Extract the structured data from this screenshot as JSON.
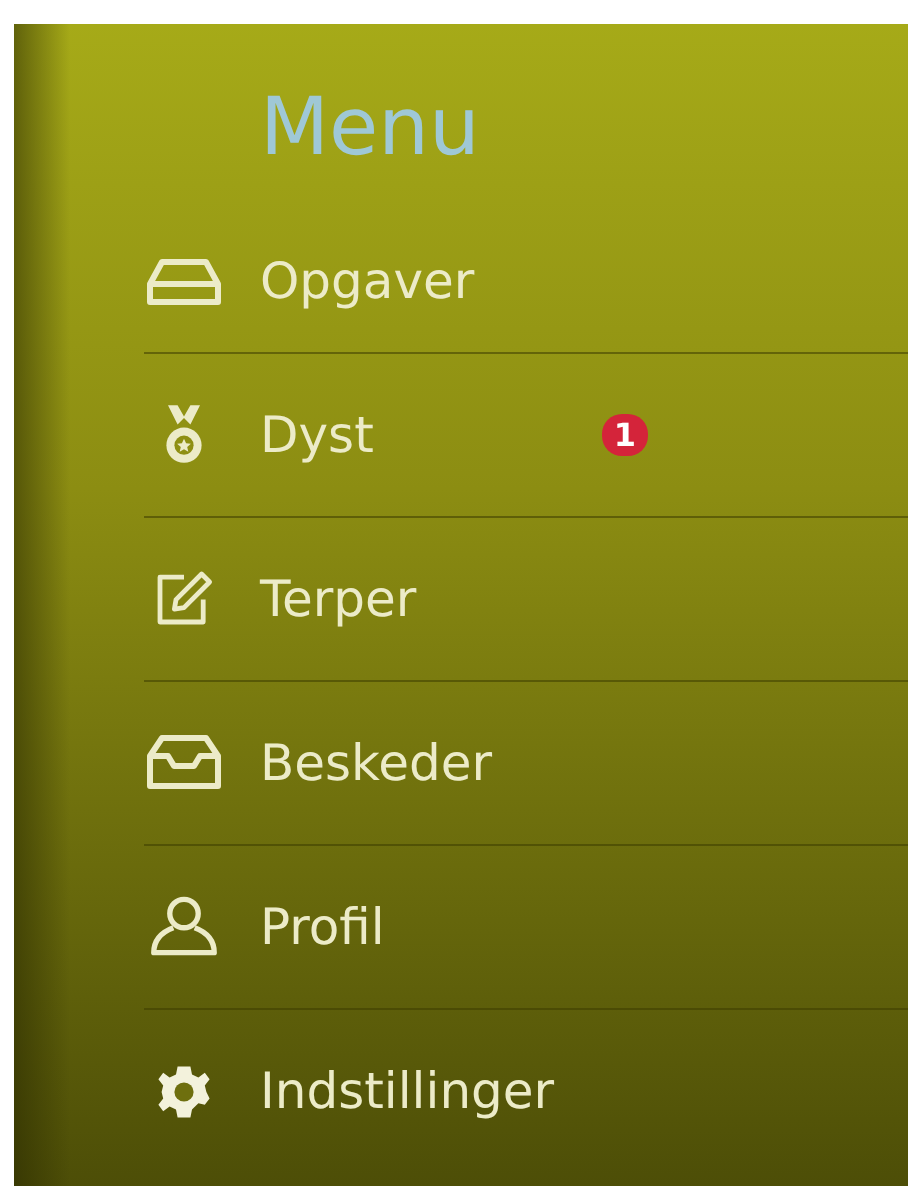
{
  "menu": {
    "title": "Menu",
    "items": [
      {
        "kind": "tray",
        "label": "Opgaver"
      },
      {
        "kind": "medal",
        "label": "Dyst",
        "badge": "1"
      },
      {
        "kind": "edit",
        "label": "Terper"
      },
      {
        "kind": "inbox",
        "label": "Beskeder"
      },
      {
        "kind": "person",
        "label": "Profil"
      },
      {
        "kind": "gear",
        "label": "Indstillinger"
      }
    ]
  }
}
